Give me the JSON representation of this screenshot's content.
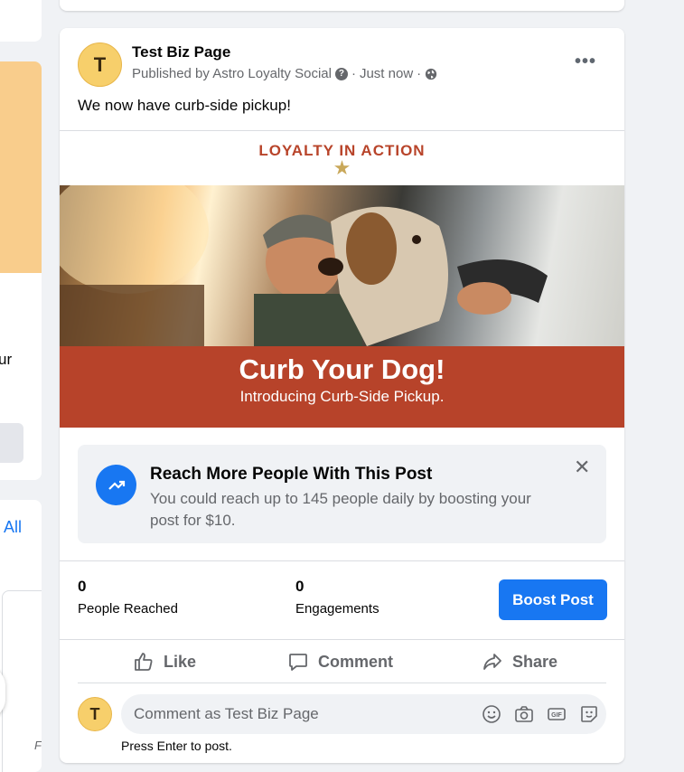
{
  "left": {
    "partial_text": "ur",
    "see_all": "All",
    "cut_letter": "F"
  },
  "post": {
    "avatar_initial": "T",
    "page_name": "Test Biz Page",
    "published_by": "Published by Astro Loyalty Social",
    "time": "Just now",
    "separator": "·",
    "text": "We now have curb-side pickup!",
    "media": {
      "headline": "LOYALTY IN ACTION",
      "title": "Curb Your Dog!",
      "subtitle": "Introducing Curb-Side Pickup."
    }
  },
  "reach": {
    "title": "Reach More People With This Post",
    "description": "You could reach up to 145 people daily by boosting your post for $10."
  },
  "stats": {
    "reached_value": "0",
    "reached_label": "People Reached",
    "engagements_value": "0",
    "engagements_label": "Engagements",
    "boost_label": "Boost Post"
  },
  "actions": {
    "like": "Like",
    "comment": "Comment",
    "share": "Share"
  },
  "comment_box": {
    "avatar_initial": "T",
    "placeholder": "Comment as Test Biz Page",
    "hint": "Press Enter to post."
  },
  "colors": {
    "accent": "#1877f2",
    "media_band": "#b7432a"
  }
}
